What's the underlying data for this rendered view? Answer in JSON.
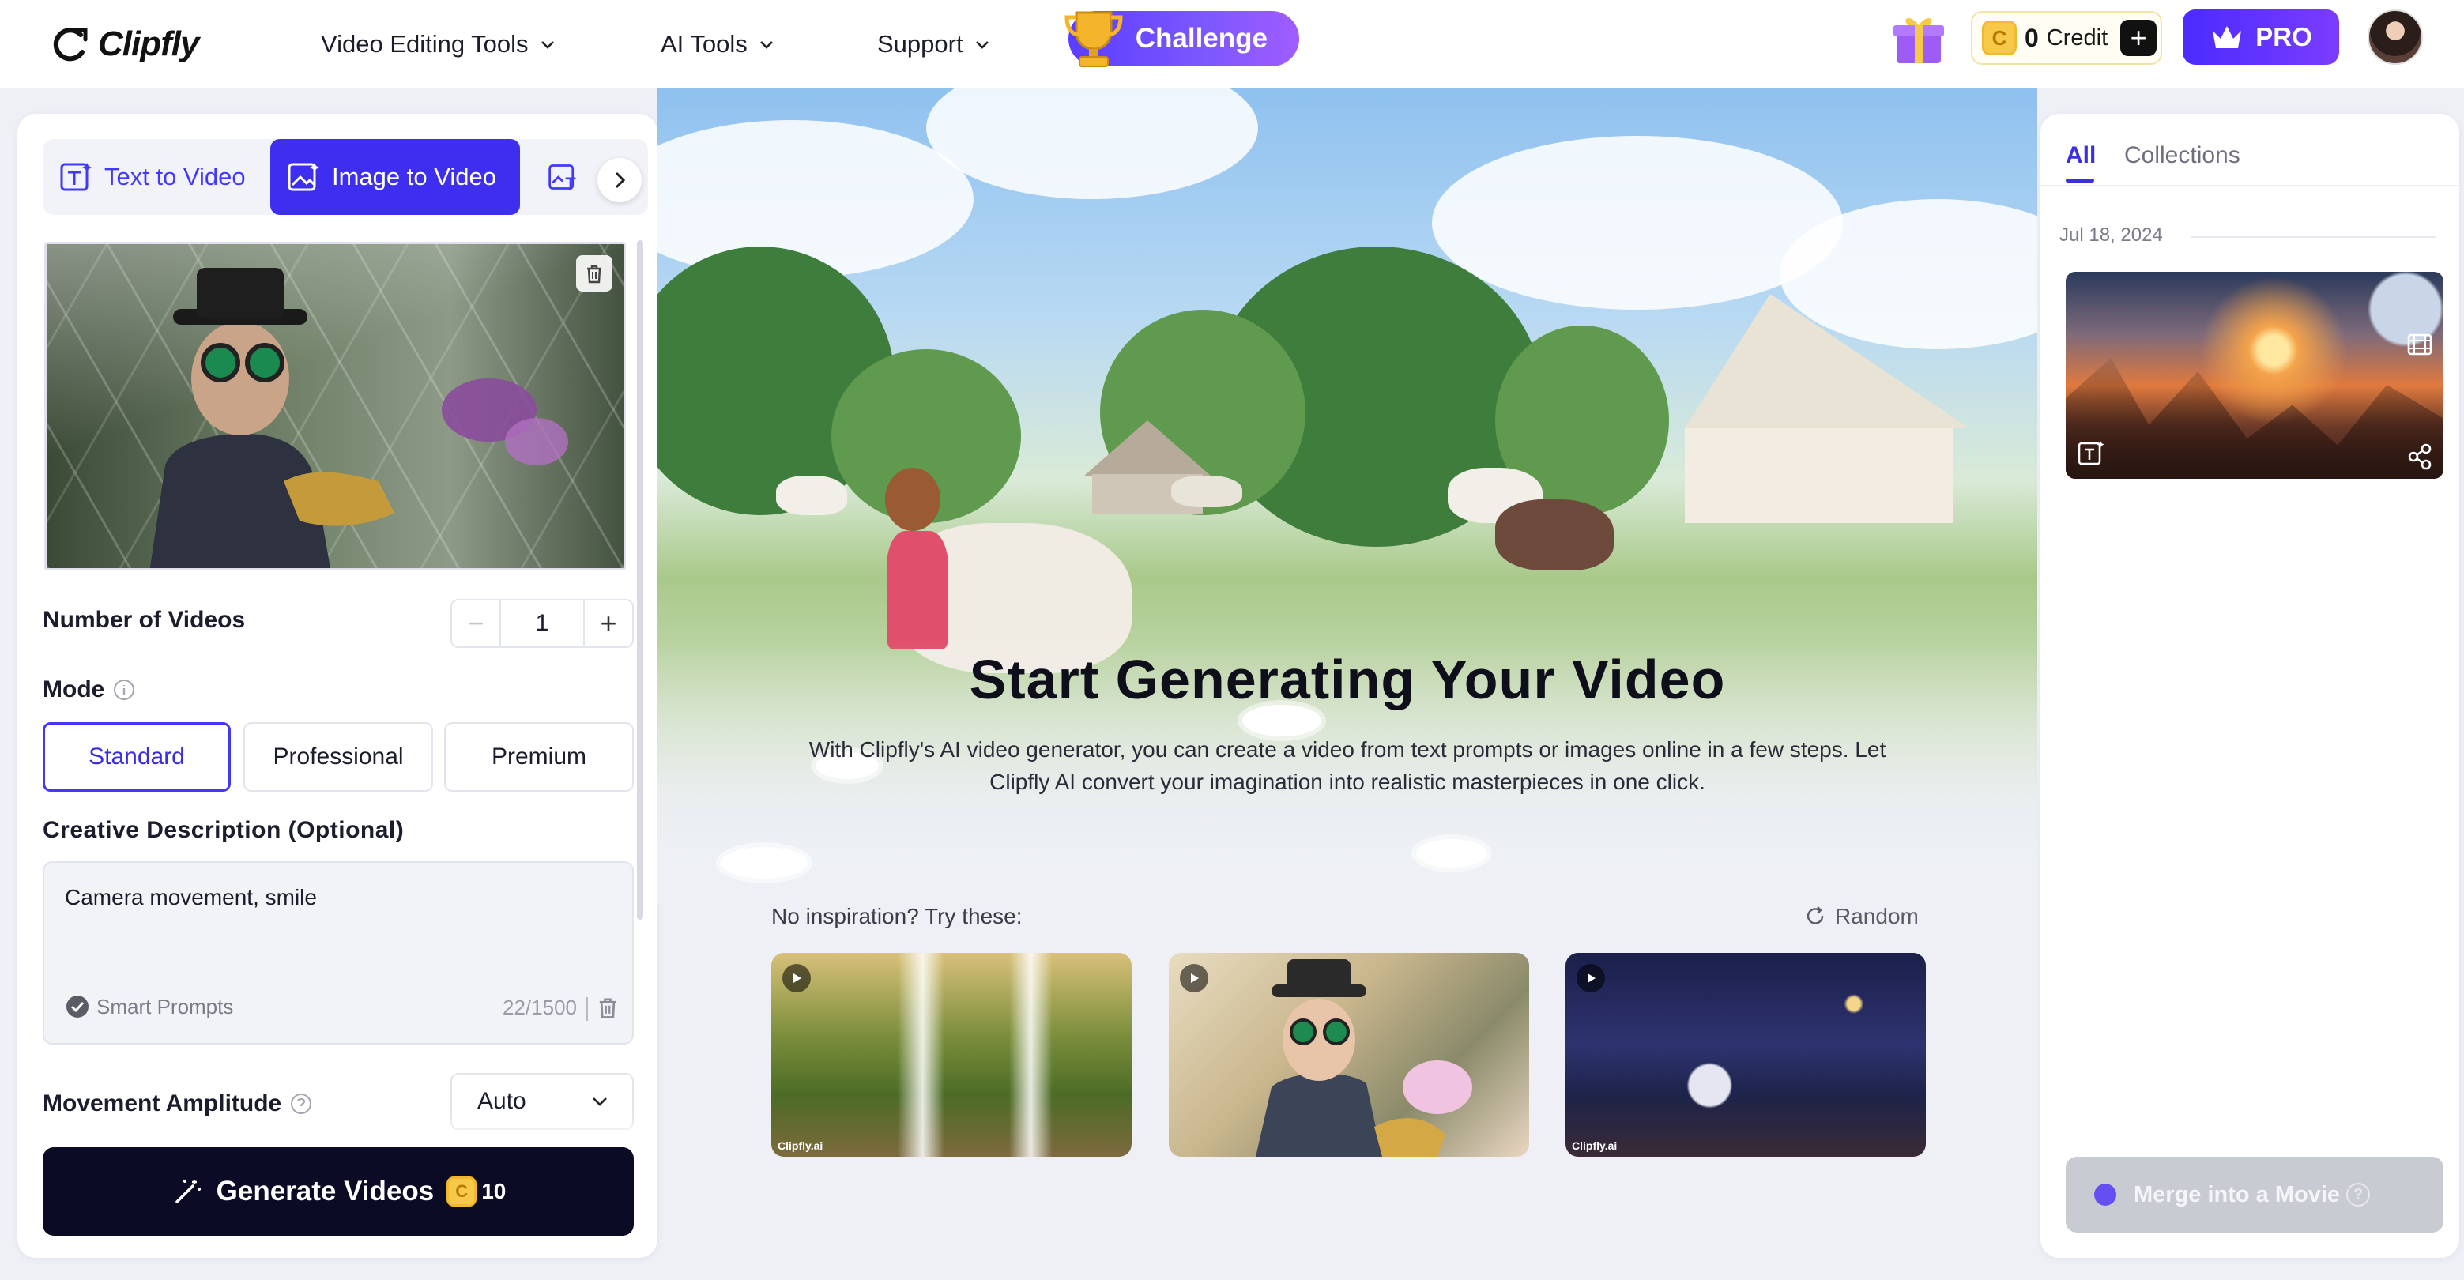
{
  "header": {
    "logo": "Clipfly",
    "nav": [
      {
        "label": "Video Editing Tools"
      },
      {
        "label": "AI Tools"
      },
      {
        "label": "Support"
      }
    ],
    "challenge_label": "Challenge",
    "credit": {
      "amount": "0",
      "label": "Credit",
      "coin_glyph": "C"
    },
    "pro_label": "PRO"
  },
  "left_panel": {
    "tabs": [
      {
        "label": "Text to Video",
        "active": false
      },
      {
        "label": "Image to Video",
        "active": true
      }
    ],
    "number_of_videos": {
      "label": "Number of Videos",
      "value": "1"
    },
    "mode": {
      "label": "Mode",
      "options": [
        "Standard",
        "Professional",
        "Premium"
      ],
      "selected": "Standard"
    },
    "creative_description": {
      "label": "Creative Description (Optional)",
      "value": "Camera movement, smile",
      "smart_prompts_label": "Smart Prompts",
      "char_count": "22/1500"
    },
    "movement_amplitude": {
      "label": "Movement Amplitude",
      "value": "Auto"
    },
    "generate": {
      "label": "Generate Videos",
      "cost": "10",
      "coin_glyph": "C"
    }
  },
  "center": {
    "title": "Start Generating Your Video",
    "subtitle": "With Clipfly's AI video generator, you can create a video from text prompts or images online in a few steps. Let Clipfly AI convert your imagination into realistic masterpieces in one click.",
    "inspiration_label": "No inspiration? Try these:",
    "random_label": "Random",
    "watermark": "Clipfly.ai"
  },
  "right_panel": {
    "tabs": [
      {
        "label": "All",
        "active": true
      },
      {
        "label": "Collections",
        "active": false
      }
    ],
    "date": "Jul 18, 2024",
    "merge_label": "Merge into a Movie",
    "merge_help": "?"
  },
  "colors": {
    "accent": "#3e2ef0",
    "generate_bg": "#0c0b26",
    "coin": "#f7c948"
  }
}
